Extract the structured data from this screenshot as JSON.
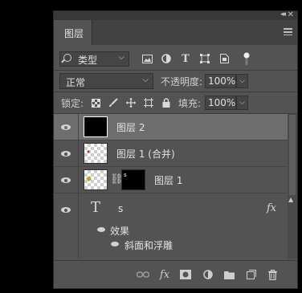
{
  "panel": {
    "tab_title": "图层",
    "filter": {
      "kind_label": "类型",
      "icons": [
        "image-filter-icon",
        "adjustment-filter-icon",
        "type-filter-icon",
        "shape-filter-icon",
        "smart-object-filter-icon",
        "filter-toggle-icon"
      ]
    },
    "blend": {
      "mode": "正常",
      "opacity_label": "不透明度:",
      "opacity_value": "100%"
    },
    "lock": {
      "label": "锁定:",
      "icons": [
        "lock-transparent-icon",
        "lock-image-icon",
        "lock-position-icon",
        "lock-artboard-icon",
        "lock-all-icon"
      ],
      "fill_label": "填充:",
      "fill_value": "100%"
    },
    "layers": [
      {
        "name": "图层 2",
        "selected": true,
        "thumb": "black"
      },
      {
        "name": "图层 1 (合并)",
        "selected": false,
        "thumb": "transparent"
      },
      {
        "name": "图层 1",
        "selected": false,
        "thumb": "linked-mask"
      },
      {
        "name": "s",
        "selected": false,
        "thumb": "type"
      }
    ],
    "effects": {
      "label": "效果",
      "items": [
        "斜面和浮雕"
      ]
    },
    "bottom_icons": [
      "link-layers-icon",
      "fx-icon",
      "add-mask-icon",
      "adjustment-layer-icon",
      "new-group-icon",
      "new-layer-icon",
      "delete-layer-icon"
    ]
  }
}
